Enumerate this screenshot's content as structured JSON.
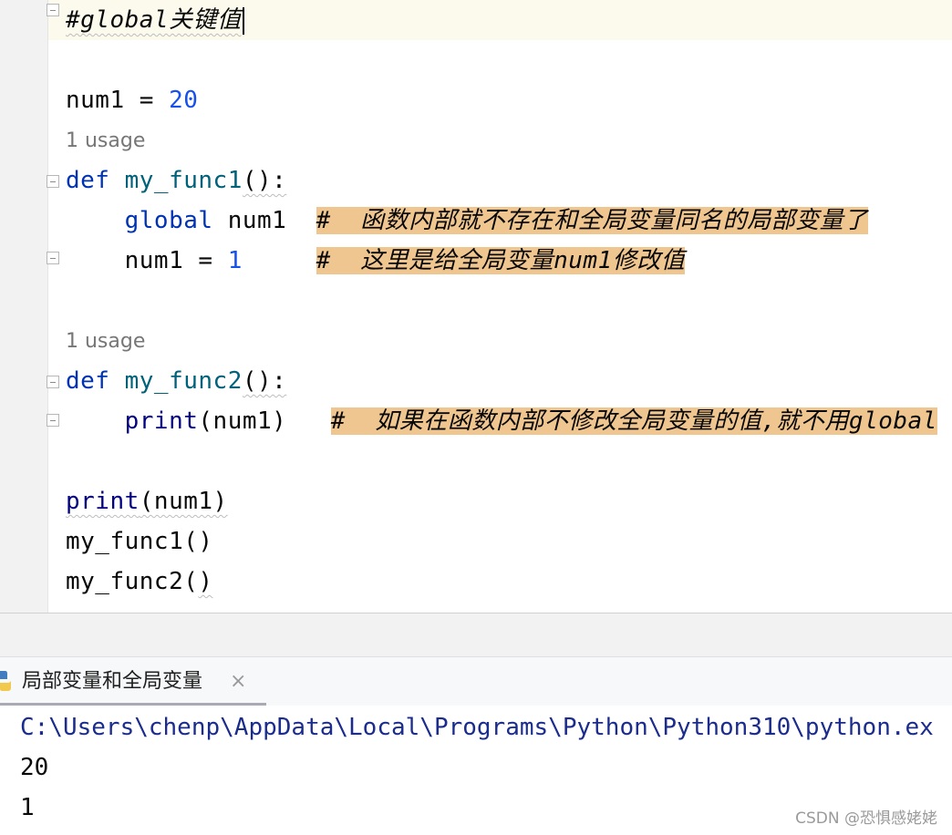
{
  "editor": {
    "lines": {
      "header_comment": "#global关键值",
      "num1_name": "num1 = ",
      "num1_value": "20",
      "usage1": "1 usage",
      "def1_kw": "def",
      "def1_name": "my_func1",
      "def1_tail": "():",
      "global_kw": "global",
      "global_var": " num1",
      "comment1": "#  函数内部就不存在和全局变量同名的局部变量了",
      "assign_name": "num1 = ",
      "assign_value": "1",
      "comment2": "#  这里是给全局变量num1修改值",
      "usage2": "1 usage",
      "def2_kw": "def",
      "def2_name": "my_func2",
      "def2_tail": "():",
      "print_kw": "print",
      "print_args": "(num1)",
      "comment3": "#  如果在函数内部不修改全局变量的值,就不用global",
      "print2_kw": "print",
      "print2_args": "(num1)",
      "call1": "my_func1()",
      "call2_name": "my_func2(",
      "call2_close": ")"
    }
  },
  "run_panel": {
    "tab_label": "局部变量和全局变量",
    "close_glyph": "×",
    "output": [
      "C:\\Users\\chenp\\AppData\\Local\\Programs\\Python\\Python310\\python.ex",
      "20",
      "1"
    ]
  },
  "watermark": "CSDN @恐惧感姥姥",
  "colors": {
    "keyword": "#0033b3",
    "function": "#00627a",
    "number": "#1750eb",
    "highlight": "#f0c690"
  }
}
